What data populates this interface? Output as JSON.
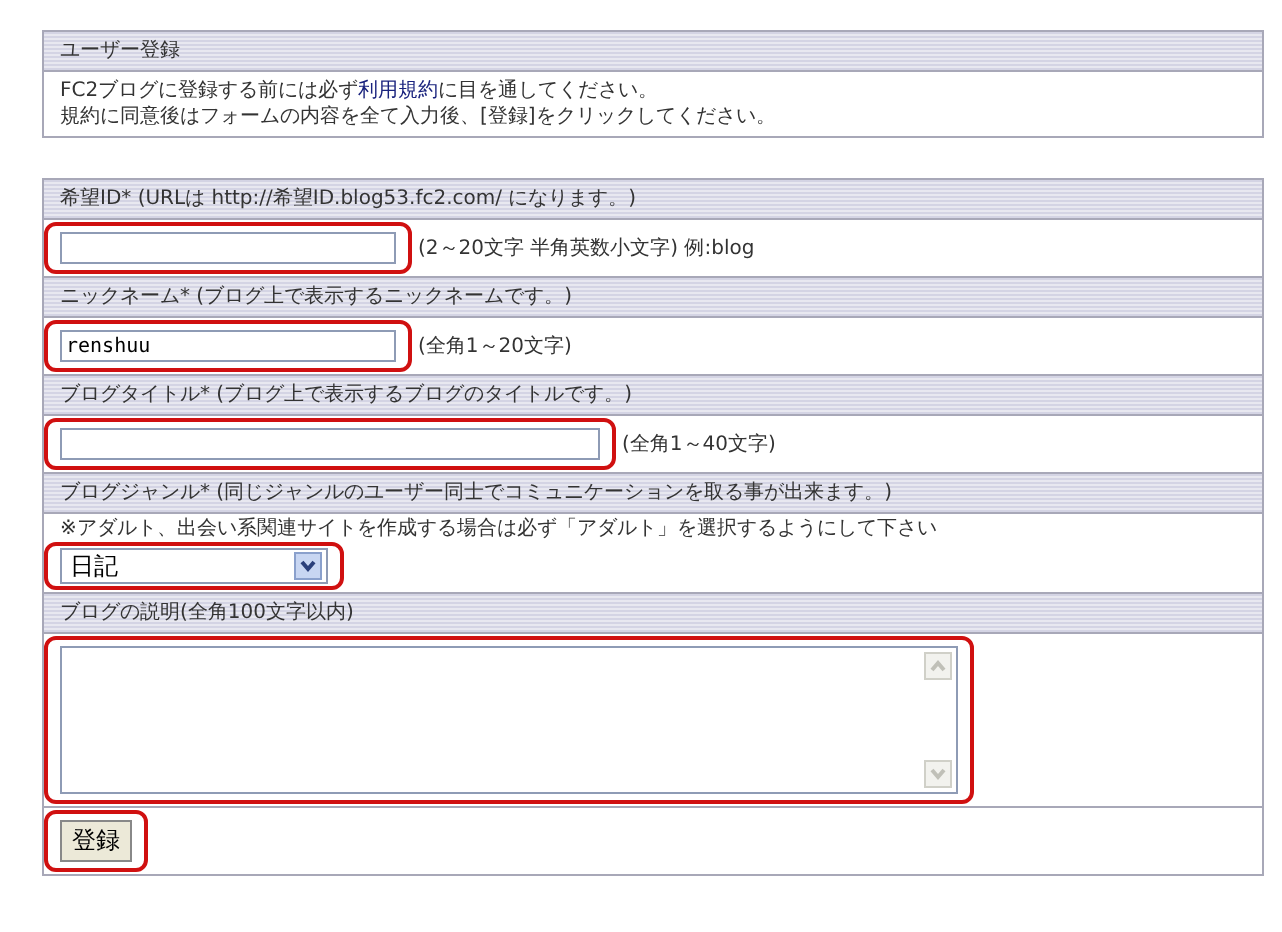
{
  "intro": {
    "title": "ユーザー登録",
    "line1_before": "FC2ブログに登録する前には必ず",
    "link": "利用規約",
    "line1_after": "に目を通してください。",
    "line2": "規約に同意後はフォームの内容を全て入力後、[登録]をクリックしてください。"
  },
  "fields": [
    {
      "label": "希望ID* (URLは http://希望ID.blog53.fc2.com/ になります。)",
      "kind": "text",
      "hint": "(2～20文字 半角英数小文字) 例:blog",
      "highlighted": true
    },
    {
      "label": "ニックネーム* (ブログ上で表示するニックネームです。)",
      "kind": "text",
      "value": "renshuu",
      "hint": "(全角1～20文字)",
      "highlighted": true
    },
    {
      "label": "ブログタイトル* (ブログ上で表示するブログのタイトルです。)",
      "kind": "text",
      "hint": "(全角1～40文字)",
      "highlighted": true
    },
    {
      "label": "ブログジャンル* (同じジャンルのユーザー同士でコミュニケーションを取る事が出来ます。)",
      "kind": "select",
      "note": "※アダルト、出会い系関連サイトを作成する場合は必ず「アダルト」を選択するようにして下さい",
      "value": "日記",
      "highlighted": true
    },
    {
      "label": "ブログの説明(全角100文字以内)",
      "kind": "textarea",
      "highlighted": true
    }
  ],
  "submit": {
    "label": "登録",
    "highlighted": true
  }
}
